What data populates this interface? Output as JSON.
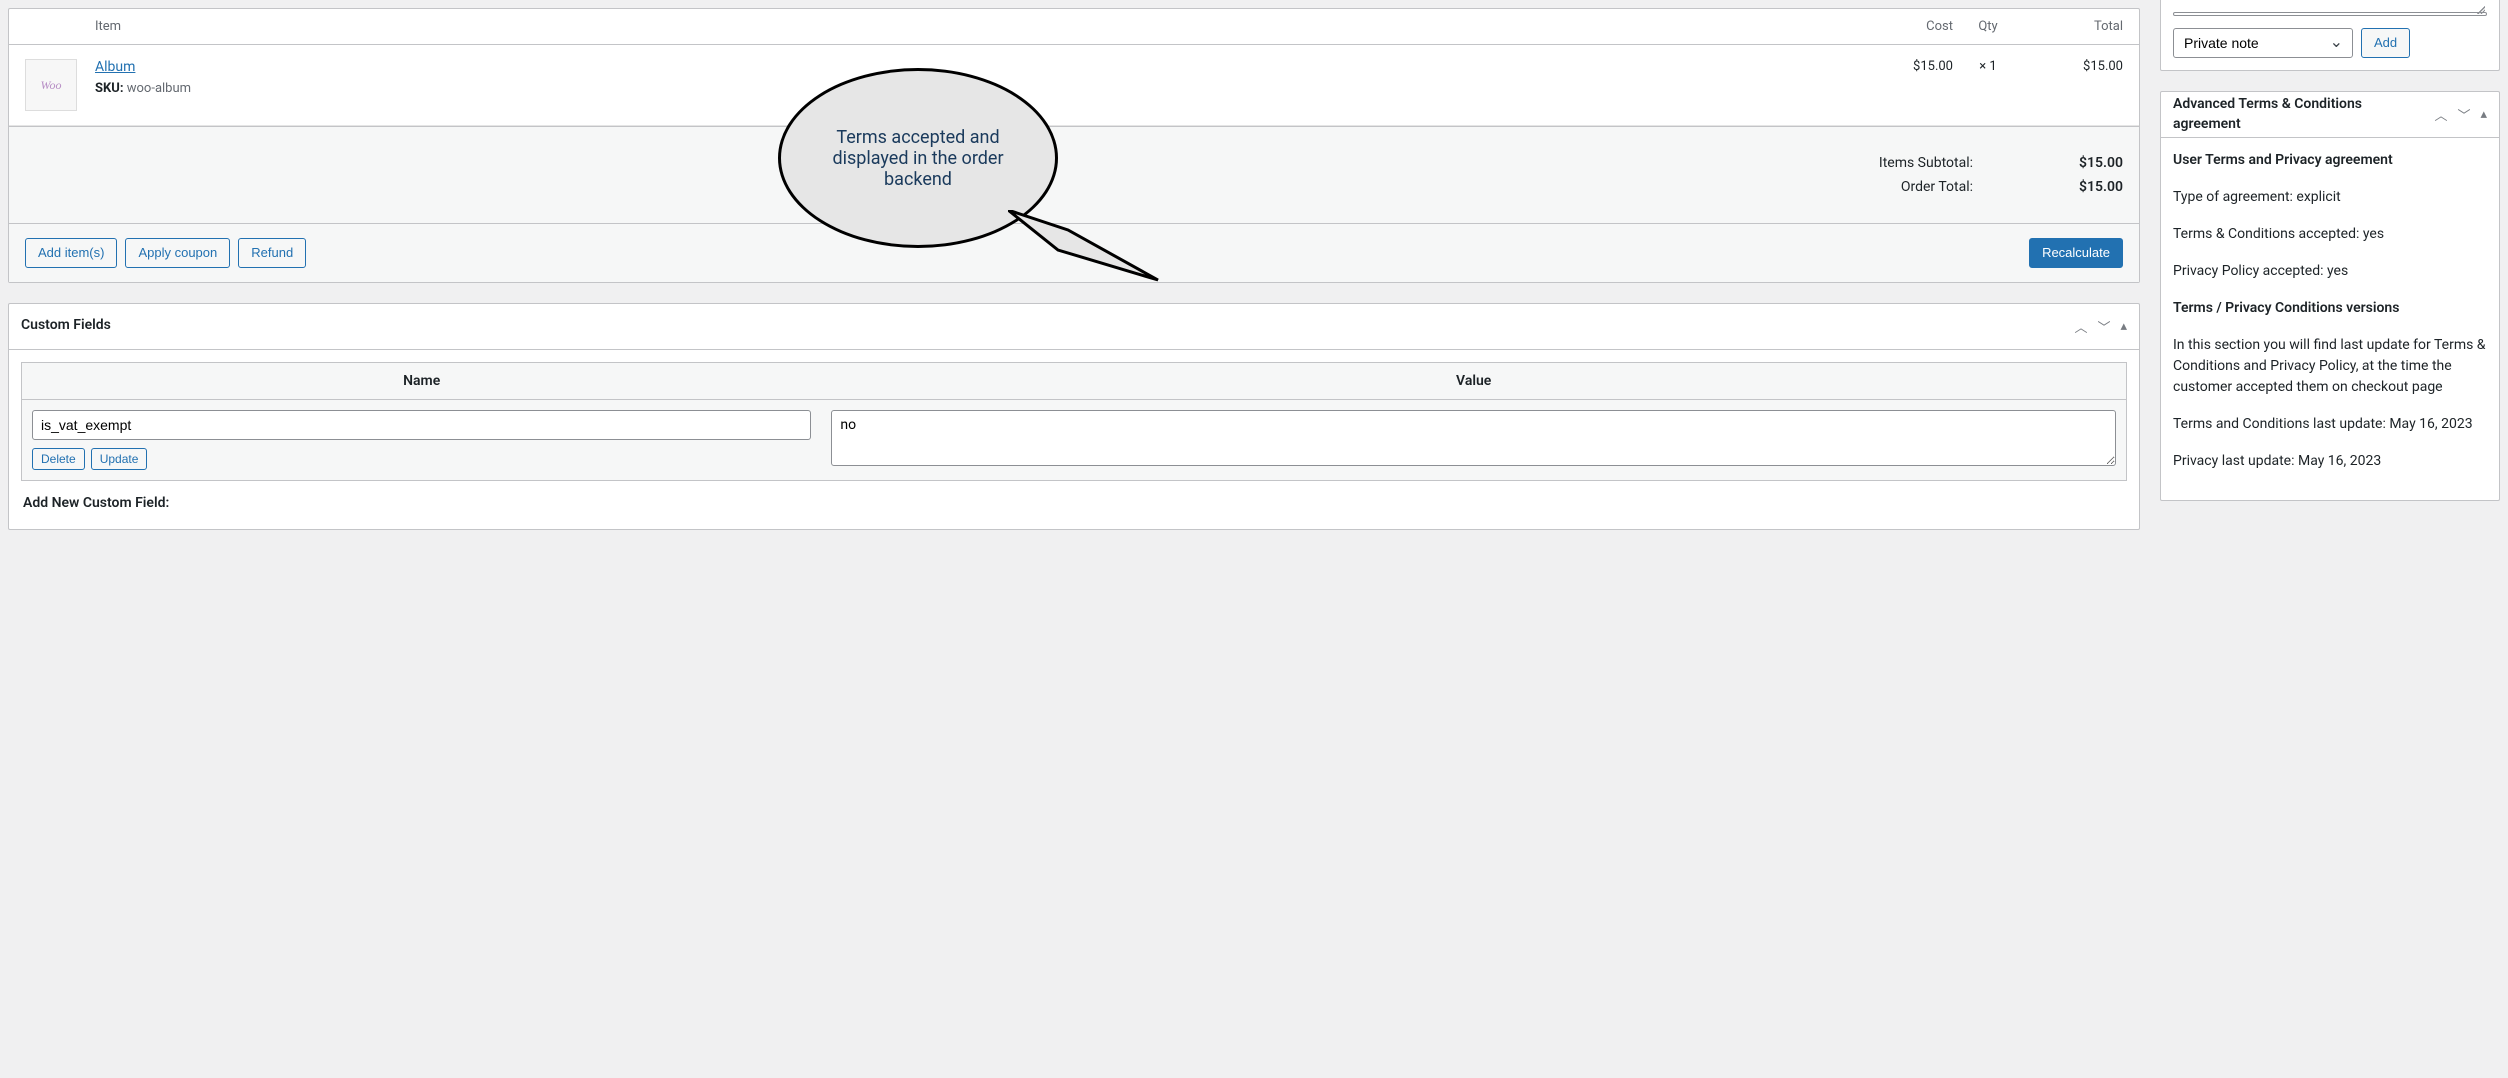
{
  "annotation": {
    "text": "Terms accepted and displayed in the order backend"
  },
  "order_items": {
    "headers": {
      "item": "Item",
      "cost": "Cost",
      "qty": "Qty",
      "total": "Total"
    },
    "rows": [
      {
        "thumb_label": "Woo",
        "name": "Album",
        "sku_label": "SKU:",
        "sku": "woo-album",
        "cost": "$15.00",
        "qty": "× 1",
        "total": "$15.00"
      }
    ],
    "totals": {
      "subtotal_label": "Items Subtotal:",
      "subtotal": "$15.00",
      "ordertotal_label": "Order Total:",
      "ordertotal": "$15.00"
    },
    "actions": {
      "add_item": "Add item(s)",
      "apply_coupon": "Apply coupon",
      "refund": "Refund",
      "recalculate": "Recalculate"
    }
  },
  "custom_fields": {
    "title": "Custom Fields",
    "cols": {
      "name": "Name",
      "value": "Value"
    },
    "rows": [
      {
        "name": "is_vat_exempt",
        "value": "no"
      }
    ],
    "buttons": {
      "delete": "Delete",
      "update": "Update"
    },
    "add_new": "Add New Custom Field:"
  },
  "notes": {
    "type_options": [
      "Private note"
    ],
    "selected": "Private note",
    "add": "Add"
  },
  "terms_panel": {
    "title": "Advanced Terms & Conditions agreement",
    "heading": "User Terms and Privacy agreement",
    "type_label": "Type of agreement: ",
    "type_value": "explicit",
    "tc_label": "Terms & Conditions accepted: ",
    "tc_value": "yes",
    "pp_label": "Privacy Policy accepted: ",
    "pp_value": "yes",
    "versions_heading": "Terms / Privacy Conditions versions",
    "versions_desc": "In this section you will find last update for Terms & Conditions and Privacy Policy, at the time the customer accepted them on checkout page",
    "tc_update_label": "Terms and Conditions last update: ",
    "tc_update_value": "May 16, 2023",
    "pp_update_label": "Privacy last update: ",
    "pp_update_value": "May 16, 2023"
  }
}
